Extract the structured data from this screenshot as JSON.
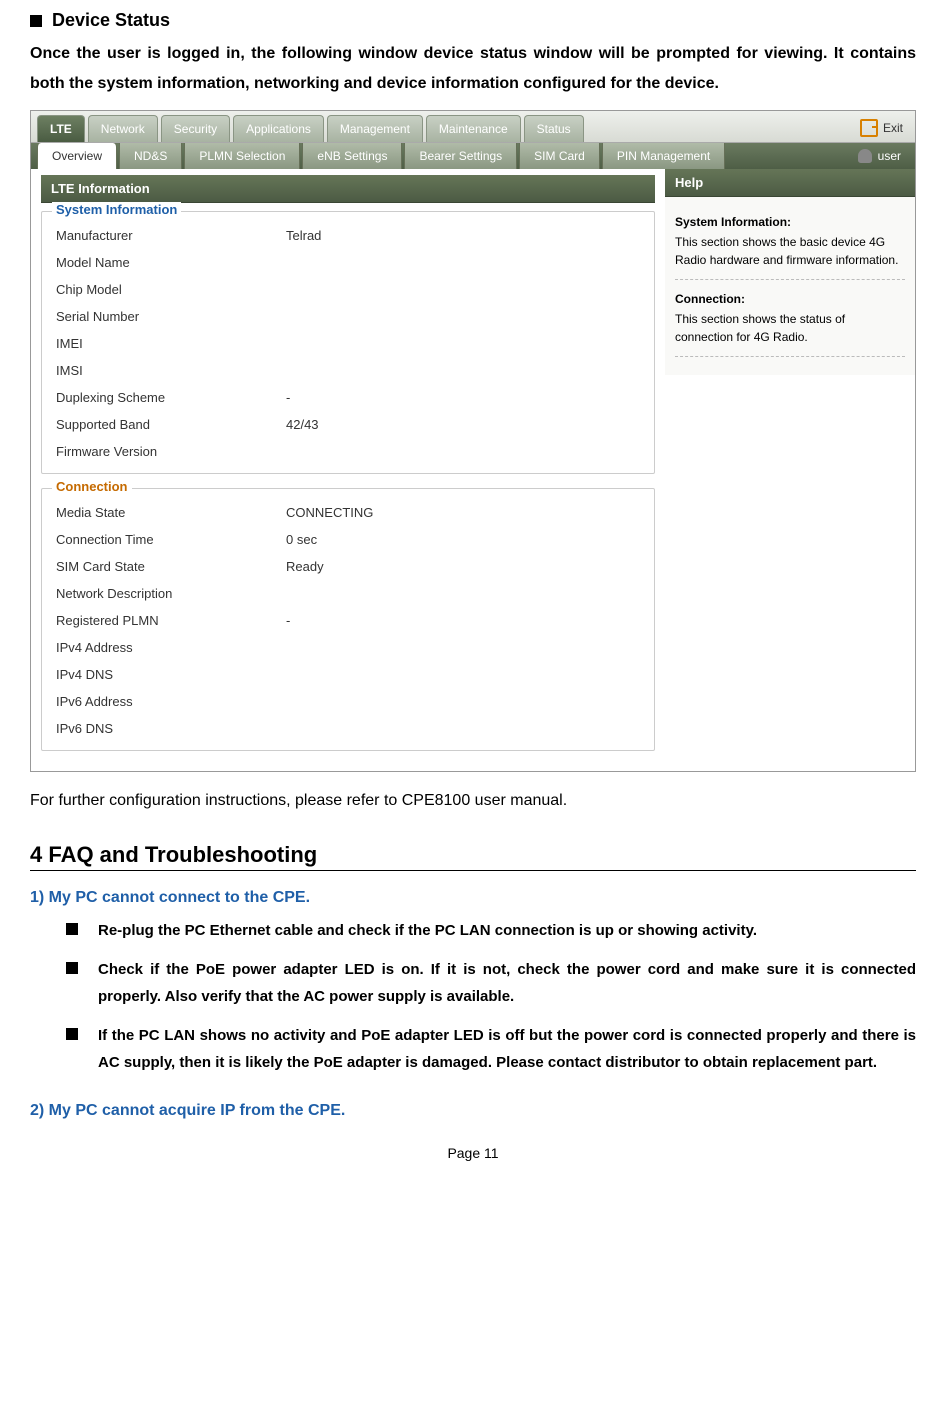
{
  "doc": {
    "heading_device_status": "Device Status",
    "intro": "Once the user is logged in, the following window device status window will be prompted for viewing. It contains both the system information, networking and device information configured for the device.",
    "post_shot": "For further configuration instructions, please refer to CPE8100 user manual.",
    "faq_heading": "4  FAQ and Troubleshooting",
    "q1": "1)   My PC cannot connect to the CPE.",
    "q1_b1": "Re-plug the PC Ethernet cable and check if the PC LAN connection is up or showing activity.",
    "q1_b2": "Check if the PoE power adapter LED is on. If it is not, check the power cord and make sure it is connected properly. Also verify that the AC power supply is available.",
    "q1_b3": "If the PC LAN shows no activity and PoE adapter LED is off but the power cord is connected properly and there is AC supply, then it is likely the PoE adapter is damaged. Please contact distributor to obtain replacement part.",
    "q2": "2)   My PC cannot acquire IP from the CPE.",
    "page": "Page 11"
  },
  "ui": {
    "tabs": {
      "lte": "LTE",
      "network": "Network",
      "security": "Security",
      "applications": "Applications",
      "management": "Management",
      "maintenance": "Maintenance",
      "status": "Status"
    },
    "exit": "Exit",
    "user": "user",
    "subtabs": {
      "overview": "Overview",
      "nds": "ND&S",
      "plmn": "PLMN Selection",
      "enb": "eNB Settings",
      "bearer": "Bearer Settings",
      "sim": "SIM Card",
      "pin": "PIN Management"
    },
    "panel_title": "LTE Information",
    "help_title": "Help",
    "help": {
      "sys_h": "System Information:",
      "sys_b": "This section shows the basic device 4G Radio hardware and firmware information.",
      "conn_h": "Connection:",
      "conn_b": "This section shows the status of connection for 4G Radio."
    },
    "sysinfo": {
      "legend": "System Information",
      "manufacturer_k": "Manufacturer",
      "manufacturer_v": "Telrad",
      "model_k": "Model Name",
      "model_v": "",
      "chip_k": "Chip Model",
      "chip_v": "",
      "serial_k": "Serial Number",
      "serial_v": "",
      "imei_k": "IMEI",
      "imei_v": "",
      "imsi_k": "IMSI",
      "imsi_v": "",
      "duplex_k": "Duplexing Scheme",
      "duplex_v": "-",
      "band_k": "Supported Band",
      "band_v": "42/43",
      "fw_k": "Firmware Version",
      "fw_v": ""
    },
    "conn": {
      "legend": "Connection",
      "media_k": "Media State",
      "media_v": "CONNECTING",
      "ctime_k": "Connection Time",
      "ctime_v": "0 sec",
      "sim_k": "SIM Card State",
      "sim_v": "Ready",
      "nd_k": "Network Description",
      "nd_v": "",
      "plmn_k": "Registered PLMN",
      "plmn_v": "-",
      "ip4_k": "IPv4 Address",
      "ip4_v": "",
      "dns4_k": "IPv4 DNS",
      "dns4_v": "",
      "ip6_k": "IPv6 Address",
      "ip6_v": "",
      "dns6_k": "IPv6 DNS",
      "dns6_v": ""
    }
  }
}
